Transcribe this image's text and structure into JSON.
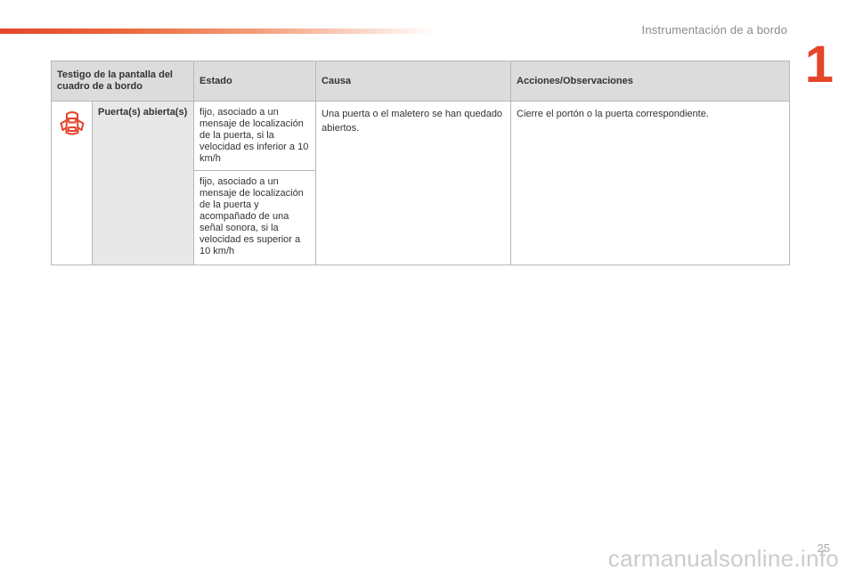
{
  "header": {
    "chapter_title": "Instrumentación de a bordo",
    "chapter_number": "1"
  },
  "table": {
    "columns": [
      "Testigo de la pantalla del cuadro de a bordo",
      "Estado",
      "Causa",
      "Acciones/Observaciones"
    ],
    "rows": [
      {
        "icon": "car-door-open-icon",
        "name": "Puerta(s) abierta(s)",
        "state_1": "fijo, asociado a un mensaje de localización de la puerta, si la velocidad es inferior a 10 km/h",
        "state_2": "fijo, asociado a un mensaje de localización de la puerta y acompañado de una señal sonora, si la velocidad es superior a 10 km/h",
        "cause": "Una puerta o el maletero se han quedado abiertos.",
        "action": "Cierre el portón o la puerta correspondiente."
      }
    ]
  },
  "footer": {
    "page_number": "25",
    "watermark": "carmanualsonline.info"
  },
  "colors": {
    "accent": "#e4452b",
    "header_bg": "#dcdcdc"
  }
}
